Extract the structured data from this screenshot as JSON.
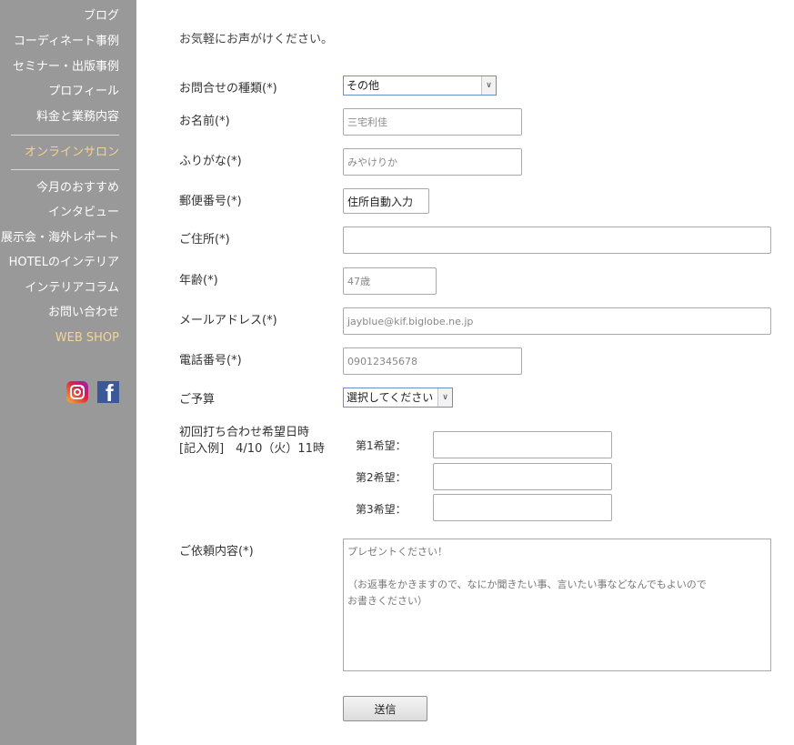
{
  "sidebar": {
    "items": [
      {
        "label": "ブログ"
      },
      {
        "label": "コーディネート事例"
      },
      {
        "label": "セミナー・出版事例"
      },
      {
        "label": "プロフィール"
      },
      {
        "label": "料金と業務内容"
      },
      {
        "label": "オンラインサロン"
      },
      {
        "label": "今月のおすすめ"
      },
      {
        "label": "インタビュー"
      },
      {
        "label": "展示会・海外レポート"
      },
      {
        "label": "HOTELのインテリア"
      },
      {
        "label": "インテリアコラム"
      },
      {
        "label": "お問い合わせ"
      },
      {
        "label": "WEB SHOP"
      }
    ],
    "social": {
      "instagram_icon": "instagram-icon",
      "facebook_icon": "facebook-icon",
      "facebook_glyph": "f"
    },
    "colors": {
      "background": "#999999",
      "highlight": "#f7d38f"
    }
  },
  "form": {
    "intro": "お気軽にお声がけください。",
    "inquiry_type": {
      "label": "お問合せの種類(*)",
      "selected": "その他"
    },
    "name": {
      "label": "お名前(*)",
      "value": "三宅利佳"
    },
    "furigana": {
      "label": "ふりがな(*)",
      "value": "みやけりか"
    },
    "postal": {
      "label": "郵便番号(*)",
      "value": "住所自動入力"
    },
    "address": {
      "label": "ご住所(*)",
      "value": ""
    },
    "age": {
      "label": "年齢(*)",
      "value": "47歳"
    },
    "email": {
      "label": "メールアドレス(*)",
      "value": "jayblue@kif.biglobe.ne.jp"
    },
    "phone": {
      "label": "電話番号(*)",
      "value": "09012345678"
    },
    "budget": {
      "label": "ご予算",
      "selected": "選択してください"
    },
    "meeting": {
      "label_line1": "初回打ち合わせ希望日時",
      "label_line2": "[記入例]　4/10（火）11時",
      "choices": [
        {
          "label": "第1希望：",
          "value": ""
        },
        {
          "label": "第2希望：",
          "value": ""
        },
        {
          "label": "第3希望：",
          "value": ""
        }
      ]
    },
    "request": {
      "label": "ご依頼内容(*)",
      "value": "プレゼントください！\n\n（お返事をかきますので、なにか聞きたい事、言いたい事などなんでもよいので\nお書きください）"
    },
    "submit_label": "送信"
  }
}
